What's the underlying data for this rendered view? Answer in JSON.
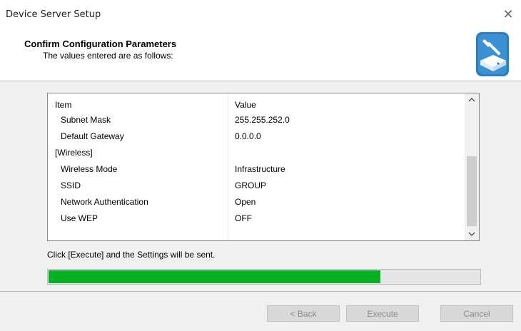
{
  "window": {
    "title": "Device Server Setup",
    "close_glyph": "✕"
  },
  "header": {
    "title": "Confirm Configuration Parameters",
    "subtitle": "The values entered are as follows:",
    "icon": "wrench-device-icon"
  },
  "list": {
    "columns": [
      "Item",
      "Value"
    ],
    "rows": [
      {
        "item": "Subnet Mask",
        "value": "255.255.252.0",
        "indent": true
      },
      {
        "item": "Default Gateway",
        "value": "0.0.0.0",
        "indent": true
      },
      {
        "item": "[Wireless]",
        "value": "",
        "indent": false
      },
      {
        "item": "Wireless Mode",
        "value": "Infrastructure",
        "indent": true
      },
      {
        "item": "SSID",
        "value": "GROUP",
        "indent": true
      },
      {
        "item": "Network Authentication",
        "value": "Open",
        "indent": true
      },
      {
        "item": "Use WEP",
        "value": "OFF",
        "indent": true
      }
    ]
  },
  "status_text": "Click [Execute] and the Settings will be sent.",
  "progress": {
    "fraction": 0.77,
    "color": "#06b025"
  },
  "buttons": {
    "back": "< Back",
    "execute": "Execute",
    "cancel": "Cancel"
  }
}
